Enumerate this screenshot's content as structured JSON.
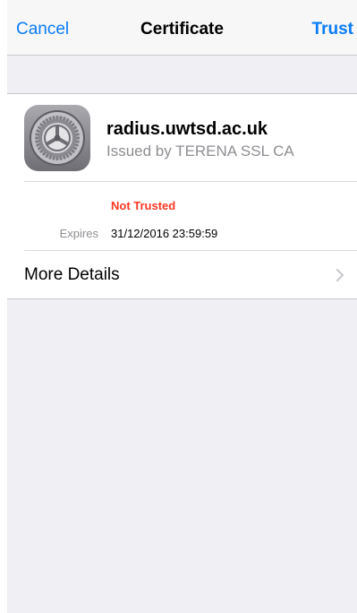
{
  "nav": {
    "cancel_label": "Cancel",
    "title": "Certificate",
    "trust_label": "Trust"
  },
  "certificate": {
    "icon": "settings-gear-icon",
    "name": "radius.uwtsd.ac.uk",
    "issuer": "Issued by TERENA SSL CA",
    "status": "Not Trusted",
    "expires_label": "Expires",
    "expires_value": "31/12/2016 23:59:59"
  },
  "details": {
    "label": "More Details",
    "icon": "chevron-right-icon"
  },
  "colors": {
    "accent": "#0a7cf6",
    "warning": "#fe3824",
    "secondary_text": "#8e8e93",
    "background": "#efeff4"
  }
}
